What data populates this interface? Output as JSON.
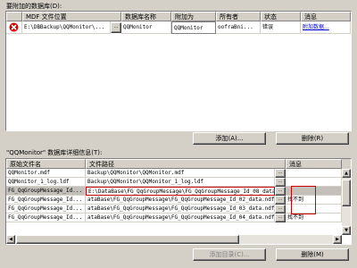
{
  "top": {
    "group_title": "要附加的数据库(D):",
    "columns": [
      "MDF 文件位置",
      "数据库名称",
      "附加为",
      "所有者",
      "状态",
      "消息"
    ],
    "rows": [
      {
        "mdf_path": "E:\\DBBackup\\QQMonitor\\...",
        "db_name": "QQMonitor",
        "attach_as": "QQMonitor",
        "owner": "oofraBni...",
        "status": "错误",
        "message": "附加数据..."
      }
    ],
    "add_button": "添加(A)...",
    "remove_button": "删除(R)"
  },
  "bottom": {
    "group_title": "\"QQMonitor\" 数据库详细信息(T):",
    "columns": [
      "原始文件名",
      "文件路径",
      "消息"
    ],
    "rows": [
      {
        "name": "QQMonitor.mdf",
        "path": "Backup\\QQMonitor\\QQMonitor.mdf",
        "message": ""
      },
      {
        "name": "QQMonitor_1_log.ldf",
        "path": "Backup\\QQMonitor\\QQMonitor_1_log.ldf",
        "message": ""
      },
      {
        "name": "FG_QqGroupMessage_Id...",
        "path": "E:\\DataBase\\FG_QqGroupMessage\\FG_QqGroupMessage_Id_08_data.",
        "message": ""
      },
      {
        "name": "FG_QqGroupMessage_Id...",
        "path": "ataBase\\FG_QqGroupMessage\\FG_QqGroupMessage_Id_02_data.ndf",
        "message": "找不到"
      },
      {
        "name": "FG_QqGroupMessage_Id...",
        "path": "ataBase\\FG_QqGroupMessage\\FG_QqGroupMessage_Id_03_data.ndf",
        "message": ""
      },
      {
        "name": "FG_QqGroupMessage_Id...",
        "path": "ataBase\\FG_QqGroupMessage\\FG_QqGroupMessage_Id_04_data.ndf",
        "message": "找不到"
      }
    ],
    "add_catalog_button": "添加目录(C)...",
    "remove_button": "删除(M)"
  },
  "browse_label": "...",
  "error_icon": "error-icon",
  "colors": {
    "window_bg": "#d4d0c8",
    "error_red": "#cc0000",
    "link_blue": "#0000cc",
    "highlight_box": "#cc0000"
  }
}
